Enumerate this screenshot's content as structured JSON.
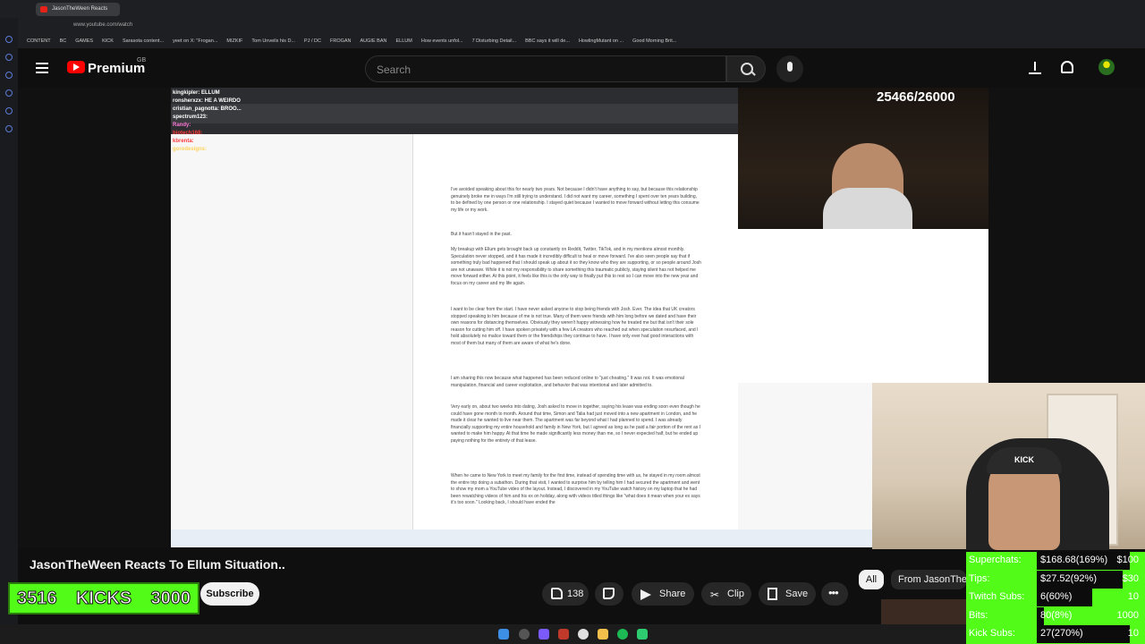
{
  "browser": {
    "tab_title": "JasonTheWeen Reacts",
    "url": "www.youtube.com/watch",
    "bookmarks": [
      "CONTENT",
      "BC",
      "GAMES",
      "KICK",
      "Sarasota content...",
      "yeet on X: \"Frogan...",
      "MIZKIF",
      "Tom Unveils his D...",
      "PJ / DC",
      "FROGAN",
      "AUGIE BAN",
      "ELLUM",
      "How events unfol...",
      "7 Disturbing Detail...",
      "BBC says it will de...",
      "HowlingMutant on ...",
      "Good Morning Brit..."
    ]
  },
  "header": {
    "logo_text": "Premium",
    "logo_region": "GB",
    "search_placeholder": "Search"
  },
  "stream": {
    "sub_goal": "25466/26000",
    "chat": [
      {
        "user": "kingkipler:",
        "msg": "ELLUM",
        "color": "#ffffff"
      },
      {
        "user": "ronsherxzx:",
        "msg": "HE A WEIRDO",
        "color": "#ffffff"
      },
      {
        "user": "cristian_pagnotta:",
        "msg": "BROO...",
        "color": "#ffffff"
      },
      {
        "user": "spectrum123:",
        "msg": "",
        "color": "#ffffff"
      },
      {
        "user": "Randy:",
        "msg": "",
        "color": "#ff7ad9"
      },
      {
        "user": "biotech168:",
        "msg": "",
        "color": "#ff3b3b"
      },
      {
        "user": "kbrenta:",
        "msg": "",
        "color": "#ff3b3b"
      },
      {
        "user": "",
        "msg": "",
        "color": "#9ec8ff"
      },
      {
        "user": "",
        "msg": "",
        "color": "#66ff66"
      },
      {
        "user": "gorodesigns:",
        "msg": "",
        "color": "#ffd35a"
      }
    ],
    "doc_paragraphs": [
      "I've avoided speaking about this for nearly two years. Not because I didn't have anything to say, but because this relationship genuinely broke me in ways I'm still trying to understand. I did not want my career, something I spent over ten years building, to be defined by one person or one relationship. I stayed quiet because I wanted to move forward without letting this consume my life or my work.",
      "But it hasn't stayed in the past.",
      "My breakup with Ellum gets brought back up constantly on Reddit, Twitter, TikTok, and in my mentions almost monthly. Speculation never stopped, and it has made it incredibly difficult to heal or move forward. I've also seen people say that if something truly bad happened that I should speak up about it so they know who they are supporting, or so people around Josh are not unaware. While it is not my responsibility to share something this traumatic publicly, staying silent has not helped me move forward either. At this point, it feels like this is the only way to finally put this to rest so I can move into the new year and focus on my career and my life again.",
      "I want to be clear from the start. I have never asked anyone to stop being friends with Josh. Ever. The idea that UK creators stopped speaking to him because of me is not true. Many of them were friends with him long before we dated and have their own reasons for distancing themselves. Obviously they weren't happy witnessing how he treated me but that isn't their sole reason for cutting him off. I have spoken privately with a few LA creators who reached out when speculation resurfaced, and I hold absolutely no malice toward them or the friendships they continue to have. I have only ever had good interactions with most of them but many of them are aware of what he's done.",
      "I am sharing this now because what happened has been reduced online to \"just cheating.\" It was not. It was emotional manipulation, financial and career exploitation, and behavior that was intentional and later admitted to.",
      "Very early on, about two weeks into dating, Josh asked to move in together, saying his lease was ending soon even though he could have gone month to month. Around that time, Simon and Talia had just moved into a new apartment in London, and he made it clear he wanted to live near them. The apartment was far beyond what I had planned to spend. I was already financially supporting my entire household and family in New York, but I agreed as long as he paid a fair portion of the rent as I wanted to make him happy. At that time he made significantly less money than me, so I never expected half, but he ended up paying nothing for the entirety of that lease.",
      "When he came to New York to meet my family for the first time, instead of spending time with us, he stayed in my room almost the entire trip doing a subathon. During that visit, I wanted to surprise him by telling him I had secured the apartment and went to show my mom a YouTube video of the layout. Instead, I discovered in my YouTube watch history on my laptop that he had been rewatching videos of him and his ex on holiday, along with videos titled things like \"what does it mean when your ex says it's too soon.\" Looking back, I should have ended the"
    ]
  },
  "video": {
    "title": "JasonTheWeen Reacts To Ellum Situation..",
    "kicks_current": "3516",
    "kicks_label": "KICKS",
    "kicks_goal": "3000",
    "subscribe_label": "Subscribe",
    "like_count": "138",
    "share_label": "Share",
    "clip_label": "Clip",
    "save_label": "Save",
    "chip_all": "All",
    "chip_from": "From JasonThe"
  },
  "stats": [
    {
      "key": "Superchats:",
      "value": "$168.68(169%)",
      "goal": "$100",
      "fraction": 1.0
    },
    {
      "key": "Tips:",
      "value": "$27.52(92%)",
      "goal": "$30",
      "fraction": 0.92
    },
    {
      "key": "Twitch Subs:",
      "value": "6(60%)",
      "goal": "10",
      "fraction": 0.6
    },
    {
      "key": "Bits:",
      "value": "80(8%)",
      "goal": "1000",
      "fraction": 0.08
    },
    {
      "key": "Kick Subs:",
      "value": "27(270%)",
      "goal": "10",
      "fraction": 1.0
    }
  ]
}
